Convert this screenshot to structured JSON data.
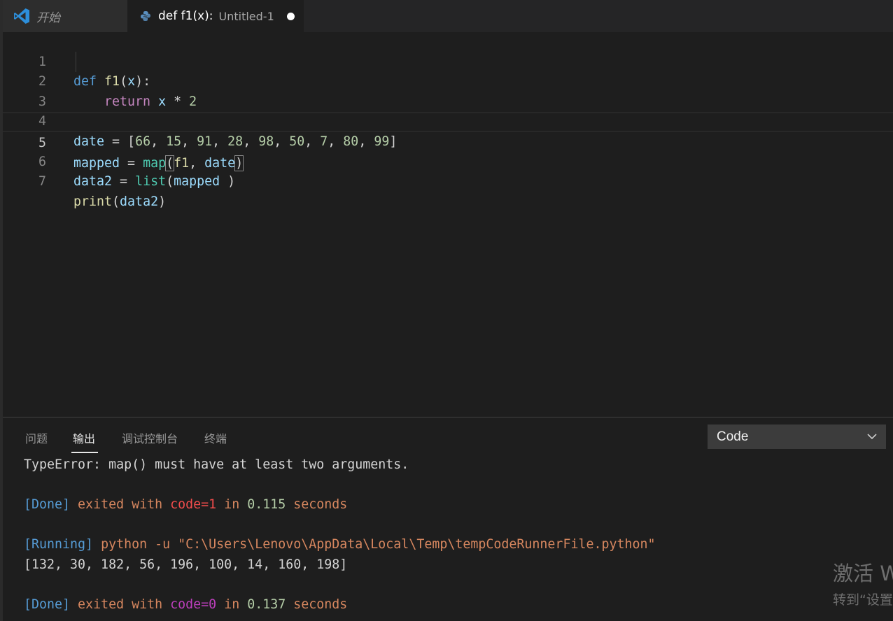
{
  "tabs": {
    "start_label": "开始",
    "active_title": "def f1(x):",
    "active_subtitle": "Untitled-1"
  },
  "editor": {
    "line_numbers": [
      "1",
      "2",
      "3",
      "4",
      "5",
      "6",
      "7"
    ],
    "current_line": "5",
    "code": {
      "l1": {
        "kw": "def",
        "fn": "f1",
        "open": "(",
        "param": "x",
        "close": "):"
      },
      "l2": {
        "kw": "return",
        "var": "x",
        "op": " * ",
        "num": "2"
      },
      "l4": {
        "var": "date",
        "assign": " = ",
        "open": "[",
        "numbers": [
          "66",
          "15",
          "91",
          "28",
          "98",
          "50",
          "7",
          "80",
          "99"
        ],
        "close": "]"
      },
      "l5": {
        "var": "mapped",
        "assign": " = ",
        "fn": "map",
        "open": "(",
        "arg1": "f1",
        "sep": ", ",
        "arg2": "date",
        "close": ")"
      },
      "l6": {
        "var": "data2",
        "assign": " = ",
        "fn": "list",
        "open": "(",
        "arg": "mapped",
        "close": " )"
      },
      "l7": {
        "fn": "print",
        "open": "(",
        "arg": "data2",
        "close": ")"
      }
    }
  },
  "panel": {
    "tabs": [
      "问题",
      "输出",
      "调试控制台",
      "终端"
    ],
    "active_tab": "输出",
    "output_source": "Code",
    "output": {
      "error_line": "TypeError: map() must have at least two arguments.",
      "done1": {
        "tag": "[Done]",
        "exited": " exited with ",
        "code": "code=1",
        "in": " in ",
        "time": "0.115",
        "seconds": " seconds"
      },
      "running": {
        "tag": "[Running]",
        "cmd": " python -u \"C:\\Users\\Lenovo\\AppData\\Local\\Temp\\tempCodeRunnerFile.python\""
      },
      "result": "[132, 30, 182, 56, 196, 100, 14, 160, 198]",
      "done2": {
        "tag": "[Done]",
        "exited": " exited with ",
        "code": "code=0",
        "in": " in ",
        "time": "0.137",
        "seconds": " seconds"
      }
    }
  },
  "watermark": {
    "line1": "激活 W",
    "line2": "转到“设置"
  },
  "colors": {
    "keyword": "#569cd6",
    "control": "#c586c0",
    "function": "#dcdcaa",
    "variable": "#9cdcfe",
    "number": "#b5cea8",
    "builtin": "#4ec9b0",
    "error_code": "#f14c4c",
    "ok_code": "#bc3fbc"
  }
}
